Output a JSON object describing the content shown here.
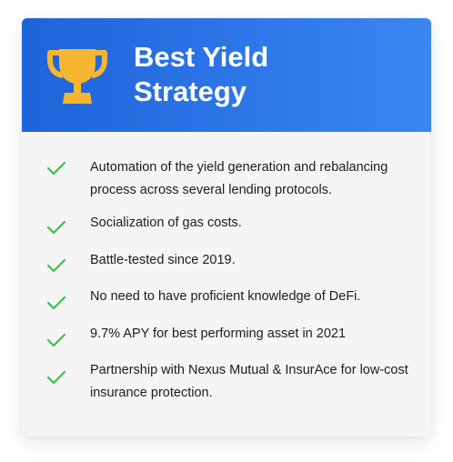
{
  "card": {
    "title_line1": "Best Yield",
    "title_line2": "Strategy",
    "header_gradient": [
      "#1f63d8",
      "#3a86f0"
    ],
    "trophy_color": "#f5b731",
    "check_color": "#3fbf4a",
    "icon": "trophy-icon"
  },
  "features": [
    {
      "text": "Automation of the yield generation and rebalancing process across several lending protocols."
    },
    {
      "text": "Socialization of gas costs."
    },
    {
      "text": "Battle-tested since 2019."
    },
    {
      "text": "No need to have proficient knowledge of DeFi."
    },
    {
      "text": "9.7% APY for best performing asset in 2021"
    },
    {
      "text": "Partnership with Nexus Mutual & InsurAce for low-cost insurance protection."
    }
  ]
}
